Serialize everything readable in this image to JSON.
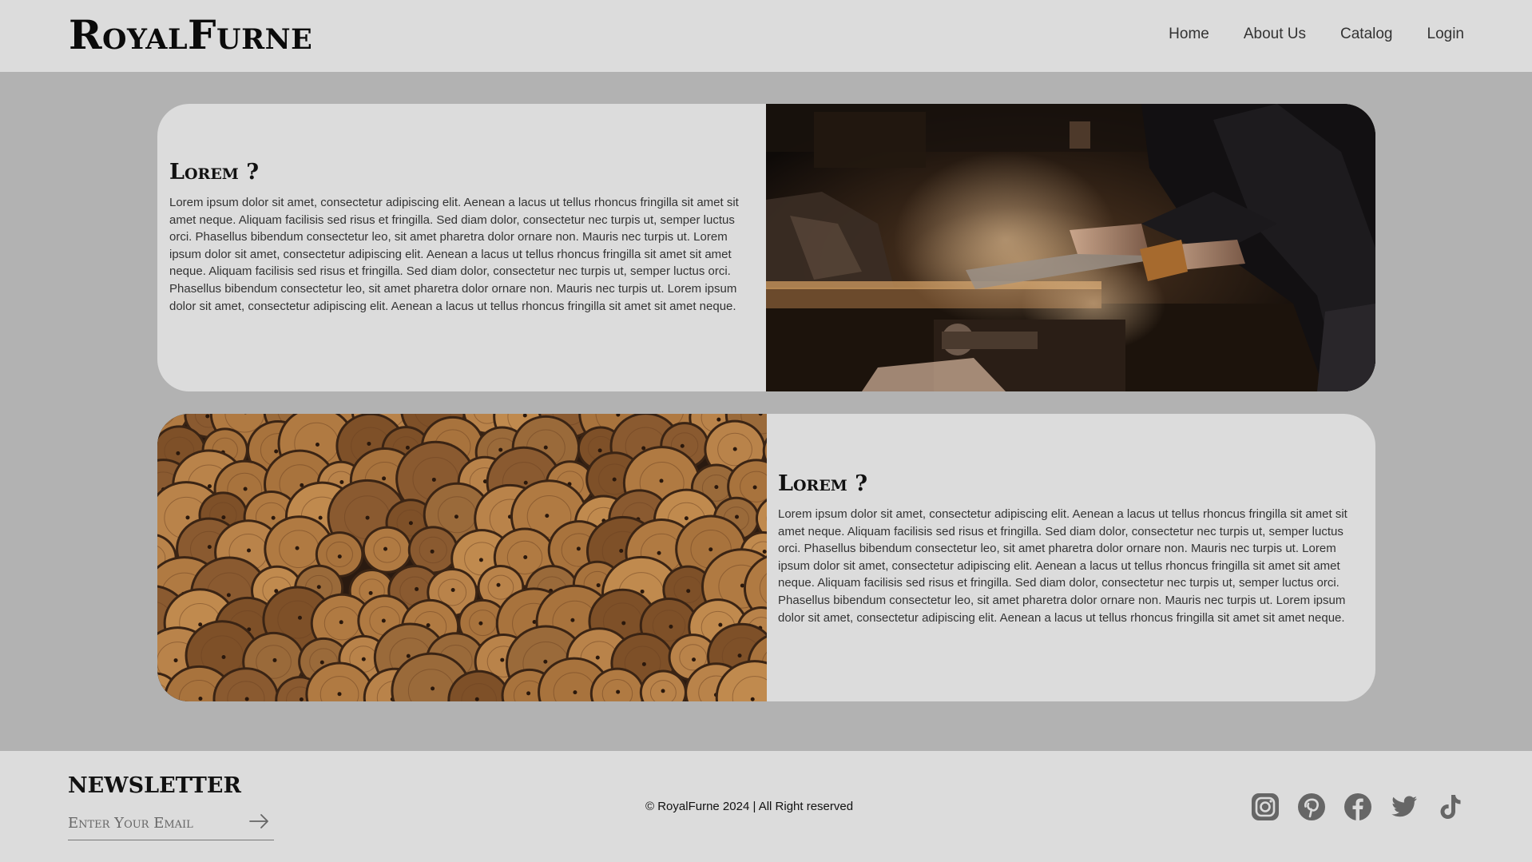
{
  "header": {
    "logo": "RoyalFurne",
    "nav": [
      "Home",
      "About Us",
      "Catalog",
      "Login"
    ]
  },
  "sections": [
    {
      "title": "Lorem ?",
      "body": "Lorem ipsum dolor sit amet, consectetur adipiscing elit. Aenean a lacus ut tellus rhoncus fringilla sit amet sit amet neque. Aliquam facilisis sed risus et fringilla. Sed diam dolor, consectetur nec turpis ut, semper luctus orci. Phasellus bibendum consectetur leo, sit amet pharetra dolor ornare non. Mauris nec turpis ut. Lorem ipsum dolor sit amet, consectetur adipiscing elit. Aenean a lacus ut tellus rhoncus fringilla sit amet sit amet neque. Aliquam facilisis sed risus et fringilla. Sed diam dolor, consectetur nec turpis ut, semper luctus orci. Phasellus bibendum consectetur leo, sit amet pharetra dolor ornare non. Mauris nec turpis ut. Lorem ipsum dolor sit amet, consectetur adipiscing elit. Aenean a lacus ut tellus rhoncus fringilla sit amet sit amet neque."
    },
    {
      "title": "Lorem ?",
      "body": "Lorem ipsum dolor sit amet, consectetur adipiscing elit. Aenean a lacus ut tellus rhoncus fringilla sit amet sit amet neque. Aliquam facilisis sed risus et fringilla. Sed diam dolor, consectetur nec turpis ut, semper luctus orci. Phasellus bibendum consectetur leo, sit amet pharetra dolor ornare non. Mauris nec turpis ut. Lorem ipsum dolor sit amet, consectetur adipiscing elit. Aenean a lacus ut tellus rhoncus fringilla sit amet sit amet neque. Aliquam facilisis sed risus et fringilla. Sed diam dolor, consectetur nec turpis ut, semper luctus orci. Phasellus bibendum consectetur leo, sit amet pharetra dolor ornare non. Mauris nec turpis ut. Lorem ipsum dolor sit amet, consectetur adipiscing elit. Aenean a lacus ut tellus rhoncus fringilla sit amet sit amet neque."
    }
  ],
  "footer": {
    "newsletter_title": "NEWSLETTER",
    "email_placeholder": "Enter Your Email",
    "copyright": "© RoyalFurne 2024 | All Right reserved",
    "socials": [
      "instagram-icon",
      "pinterest-icon",
      "facebook-icon",
      "twitter-icon",
      "tiktok-icon"
    ]
  },
  "colors": {
    "header_bg": "#dcdcdc",
    "page_bg": "#b2b2b2",
    "card_bg": "#dcdcdc",
    "icon": "#666666"
  }
}
